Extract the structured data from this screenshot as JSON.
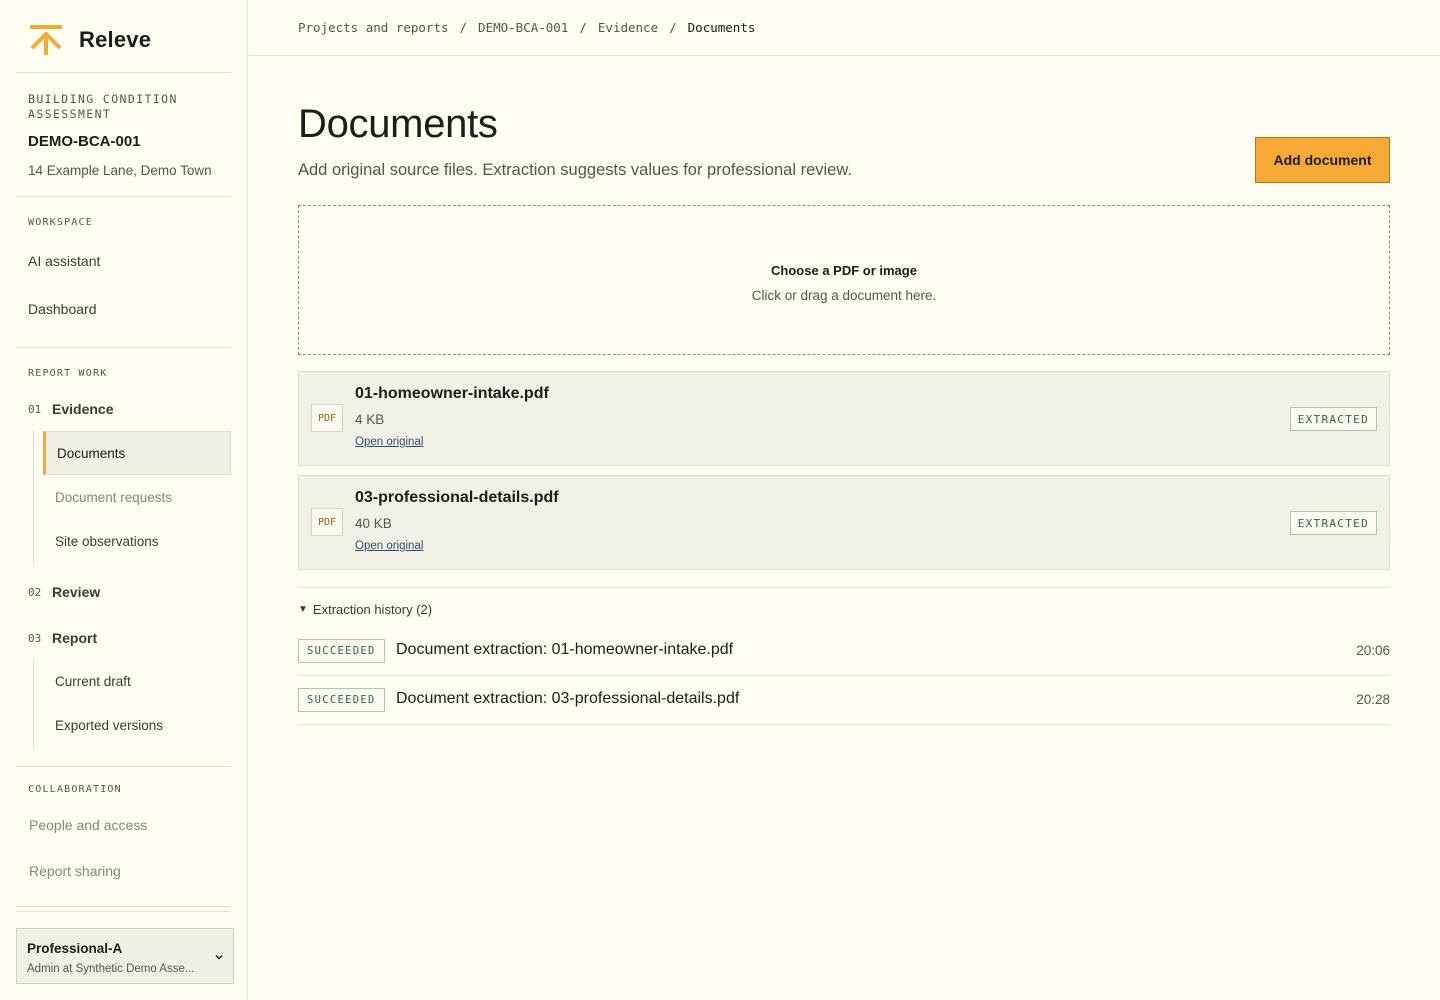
{
  "brand": {
    "name": "Releve"
  },
  "project": {
    "type": "BUILDING CONDITION ASSESSMENT",
    "code": "DEMO-BCA-001",
    "address": "14 Example Lane, Demo Town"
  },
  "sidebar": {
    "workspace_label": "WORKSPACE",
    "workspace_items": [
      "AI assistant",
      "Dashboard"
    ],
    "report_work_label": "REPORT WORK",
    "steps": [
      {
        "num": "01",
        "label": "Evidence",
        "sub": [
          "Documents",
          "Document requests",
          "Site observations"
        ]
      },
      {
        "num": "02",
        "label": "Review"
      },
      {
        "num": "03",
        "label": "Report",
        "sub": [
          "Current draft",
          "Exported versions"
        ]
      }
    ],
    "collaboration_label": "COLLABORATION",
    "collaboration_items": [
      "People and access",
      "Report sharing"
    ]
  },
  "account": {
    "name": "Professional-A",
    "role": "Admin at Synthetic Demo Asse..."
  },
  "breadcrumb": [
    "Projects and reports",
    "DEMO-BCA-001",
    "Evidence",
    "Documents"
  ],
  "page": {
    "title": "Documents",
    "subtitle": "Add original source files. Extraction suggests values for professional review.",
    "add_button": "Add document"
  },
  "dropzone": {
    "title": "Choose a PDF or image",
    "hint": "Click or drag a document here."
  },
  "documents": [
    {
      "type": "PDF",
      "name": "01-homeowner-intake.pdf",
      "size": "4 KB",
      "link": "Open original",
      "status": "EXTRACTED"
    },
    {
      "type": "PDF",
      "name": "03-professional-details.pdf",
      "size": "40 KB",
      "link": "Open original",
      "status": "EXTRACTED"
    }
  ],
  "history": {
    "toggle_label": "Extraction history (2)",
    "rows": [
      {
        "status": "SUCCEEDED",
        "text": "Document extraction: 01-homeowner-intake.pdf",
        "time": "20:06"
      },
      {
        "status": "SUCCEEDED",
        "text": "Document extraction: 03-professional-details.pdf",
        "time": "20:28"
      }
    ]
  },
  "colors": {
    "accent": "#f6a935",
    "background": "#fefef3",
    "success": "#2d6a44"
  }
}
